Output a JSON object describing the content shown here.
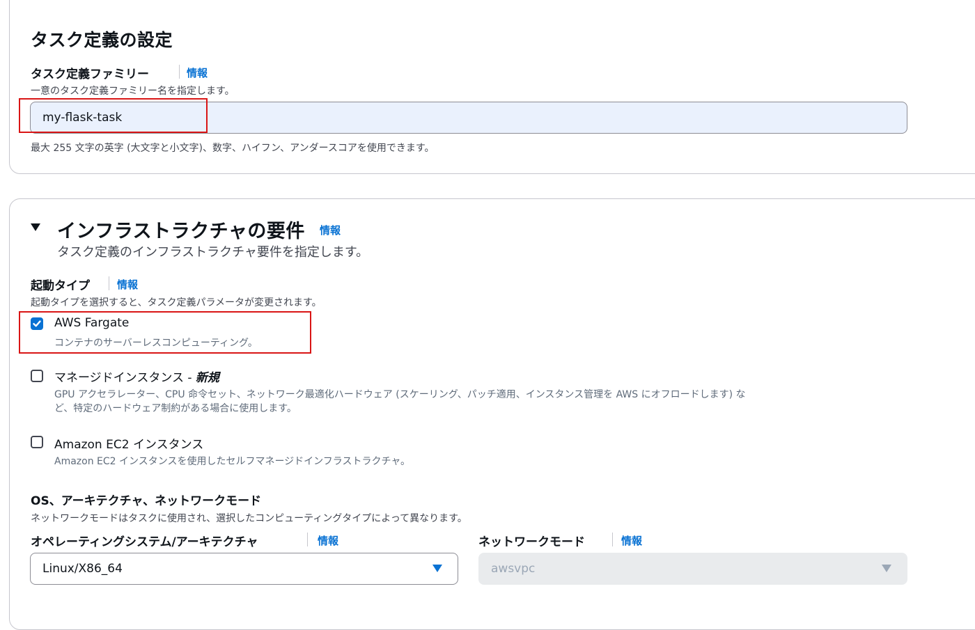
{
  "task_definition": {
    "heading": "タスク定義の設定",
    "family_label": "タスク定義ファミリー",
    "info": "情報",
    "family_description": "一意のタスク定義ファミリー名を指定します。",
    "family_value": "my-flask-task",
    "family_hint": "最大 255 文字の英字 (大文字と小文字)、数字、ハイフン、アンダースコアを使用できます。"
  },
  "infrastructure": {
    "heading": "インフラストラクチャの要件",
    "info": "情報",
    "description": "タスク定義のインフラストラクチャ要件を指定します。",
    "launch_type": {
      "label": "起動タイプ",
      "info": "情報",
      "description": "起動タイプを選択すると、タスク定義パラメータが変更されます。",
      "options": [
        {
          "title": "AWS Fargate",
          "description": "コンテナのサーバーレスコンピューティング。",
          "checked": true
        },
        {
          "title": "マネージドインスタンス - ",
          "title_emphasis": "新規",
          "description_line1": "GPU アクセラレーター、CPU 命令セット、ネットワーク最適化ハードウェア (スケーリング、パッチ適用、インスタンス管理を AWS にオフロードします) な",
          "description_line2": "ど、特定のハードウェア制約がある場合に使用します。",
          "checked": false
        },
        {
          "title": "Amazon EC2 インスタンス",
          "description": "Amazon EC2 インスタンスを使用したセルフマネージドインフラストラクチャ。",
          "checked": false
        }
      ]
    },
    "os_network": {
      "label": "OS、アーキテクチャ、ネットワークモード",
      "description": "ネットワークモードはタスクに使用され、選択したコンピューティングタイプによって異なります。",
      "os_label": "オペレーティングシステム/アーキテクチャ",
      "os_info": "情報",
      "os_value": "Linux/X86_64",
      "network_label": "ネットワークモード",
      "network_info": "情報",
      "network_value": "awsvpc"
    }
  },
  "colors": {
    "accent": "#0972d3",
    "highlight_box": "#d91515",
    "input_bg": "#eaf1fd"
  }
}
